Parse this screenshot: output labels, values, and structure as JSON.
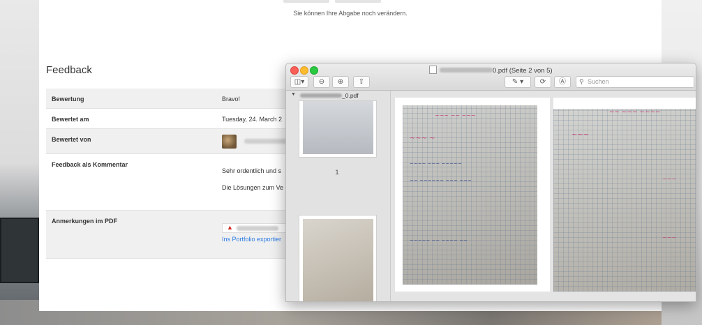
{
  "page": {
    "notice": "Sie können Ihre Abgabe noch verändern.",
    "feedback_title": "Feedback",
    "rows": [
      {
        "key": "Bewertung",
        "value": "Bravo!"
      },
      {
        "key": "Bewertet am",
        "value": "Tuesday, 24. March 2"
      },
      {
        "key": "Bewertet von",
        "value": ""
      },
      {
        "key": "Feedback als Kommentar",
        "line1": "Sehr ordentlich und s",
        "line2": "Die Lösungen zum Ve"
      },
      {
        "key": "Anmerkungen im PDF",
        "link": "Ins Portfolio exportier"
      }
    ]
  },
  "preview": {
    "title_suffix": "0.pdf (Seite 2 von 5)",
    "search_placeholder": "Suchen",
    "sidebar_file_suffix": "_0.pdf",
    "thumb_label": "1",
    "icons": [
      "sidebar-toggle-icon",
      "zoom-out-icon",
      "zoom-in-icon",
      "share-icon",
      "markup-pen-icon",
      "rotate-icon",
      "annotate-icon",
      "search-icon"
    ]
  },
  "colors": {
    "link": "#2a7ae2",
    "close": "#fc5f57",
    "minimize": "#fdbc2e",
    "zoom": "#29c941"
  }
}
